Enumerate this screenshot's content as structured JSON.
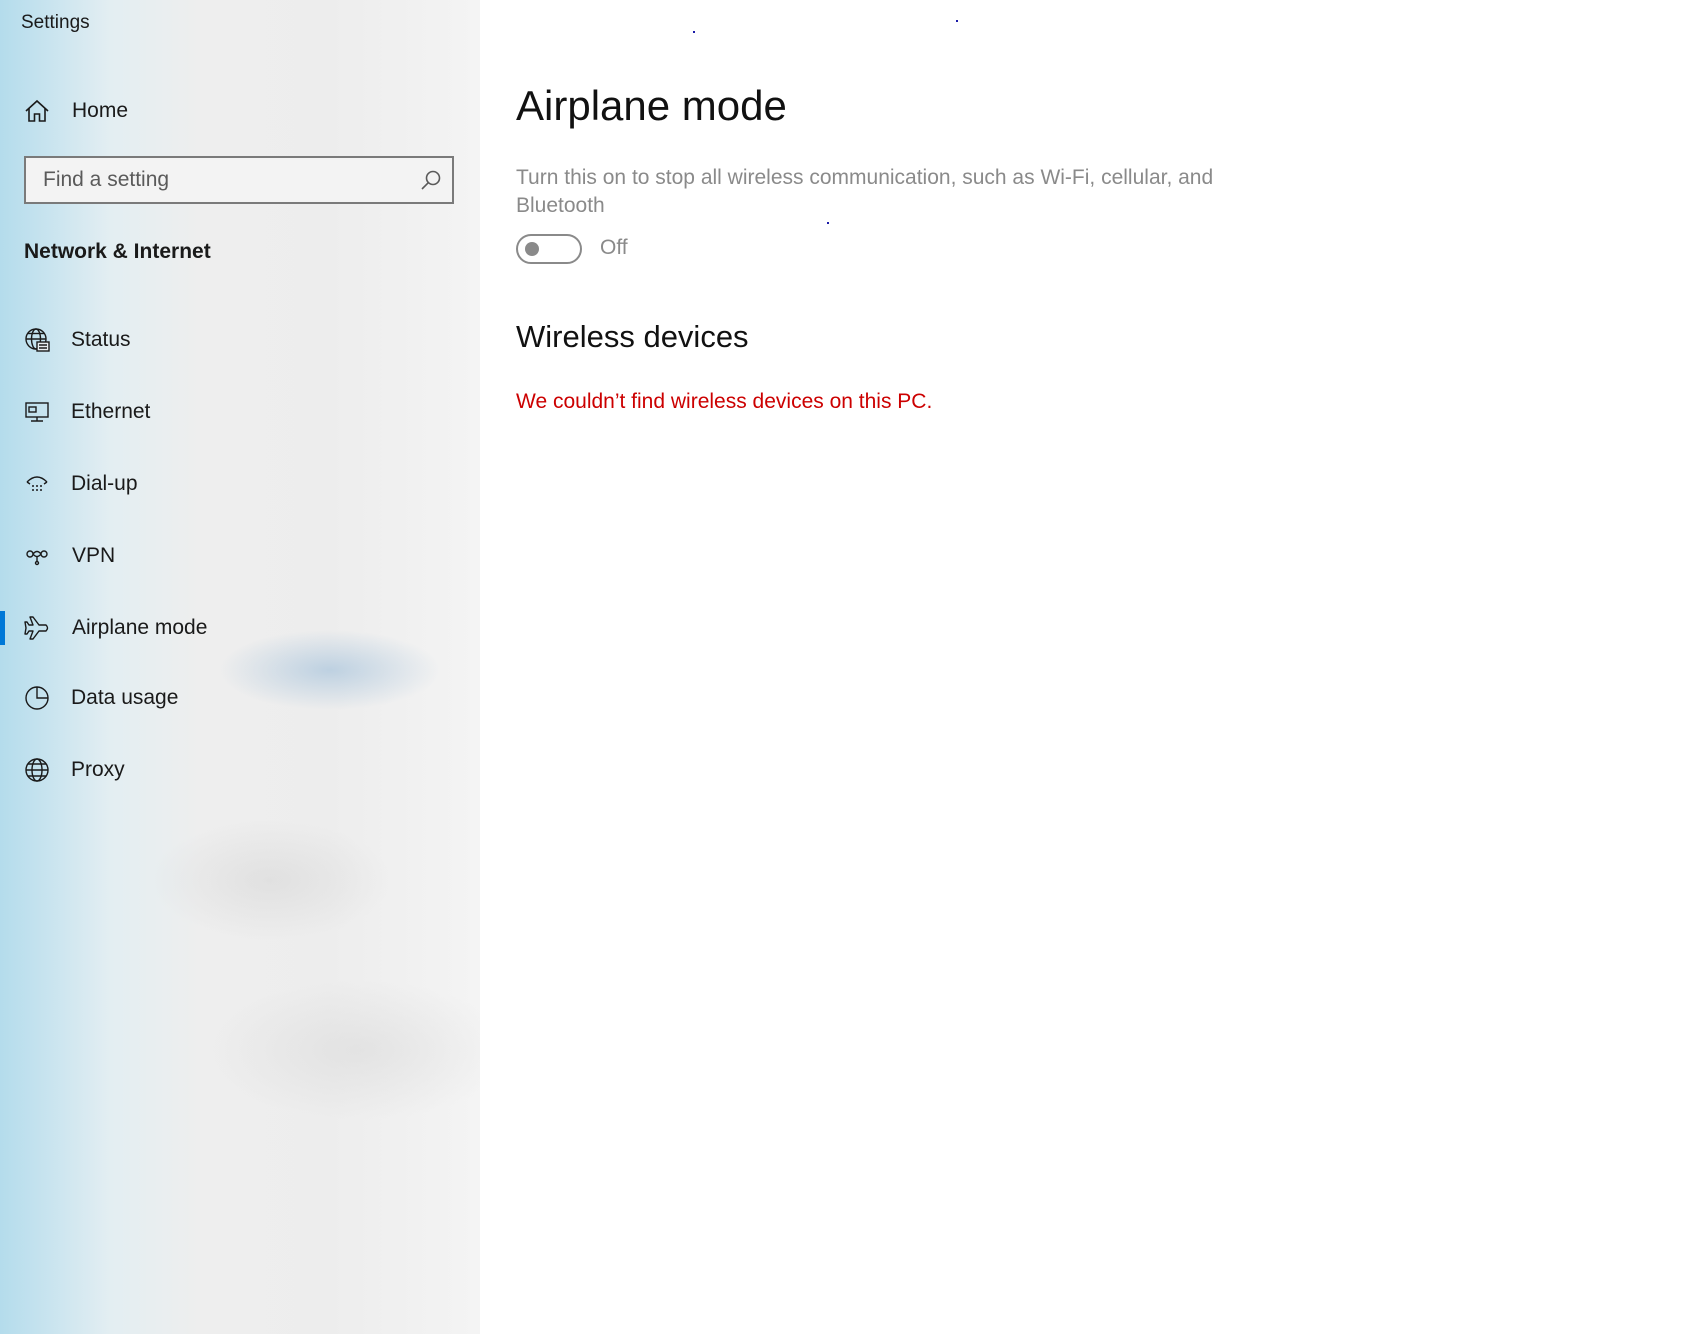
{
  "app": {
    "title": "Settings"
  },
  "sidebar": {
    "home_label": "Home",
    "search": {
      "placeholder": "Find a setting",
      "value": ""
    },
    "section_title": "Network & Internet",
    "items": [
      {
        "label": "Status",
        "icon": "status-globe-icon",
        "selected": false
      },
      {
        "label": "Ethernet",
        "icon": "ethernet-icon",
        "selected": false
      },
      {
        "label": "Dial-up",
        "icon": "dial-up-icon",
        "selected": false
      },
      {
        "label": "VPN",
        "icon": "vpn-icon",
        "selected": false
      },
      {
        "label": "Airplane mode",
        "icon": "airplane-icon",
        "selected": true
      },
      {
        "label": "Data usage",
        "icon": "data-usage-icon",
        "selected": false
      },
      {
        "label": "Proxy",
        "icon": "proxy-globe-icon",
        "selected": false
      }
    ]
  },
  "main": {
    "title": "Airplane mode",
    "description": "Turn this on to stop all wireless communication, such as Wi-Fi, cellular, and Bluetooth",
    "toggle": {
      "state_label": "Off",
      "on": false
    },
    "wireless_title": "Wireless devices",
    "wireless_message": "We couldn’t find wireless devices on this PC."
  },
  "colors": {
    "accent": "#0078d7",
    "error": "#cc0000",
    "muted_text": "#8a8a8a"
  }
}
